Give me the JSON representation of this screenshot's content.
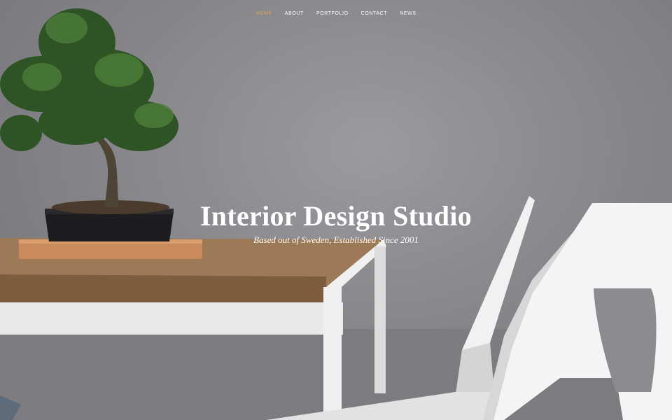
{
  "nav": {
    "items": [
      {
        "label": "HOME",
        "active": true
      },
      {
        "label": "ABOUT",
        "active": false
      },
      {
        "label": "PORTFOLIO",
        "active": false
      },
      {
        "label": "CONTACT",
        "active": false
      },
      {
        "label": "NEWS",
        "active": false
      }
    ],
    "active_color": "#d8a55a"
  },
  "hero": {
    "title": "Interior Design Studio",
    "subtitle": "Based out of Sweden, Established Since 2001"
  },
  "images": {
    "background": "bonsai-table-chairs-photo"
  }
}
